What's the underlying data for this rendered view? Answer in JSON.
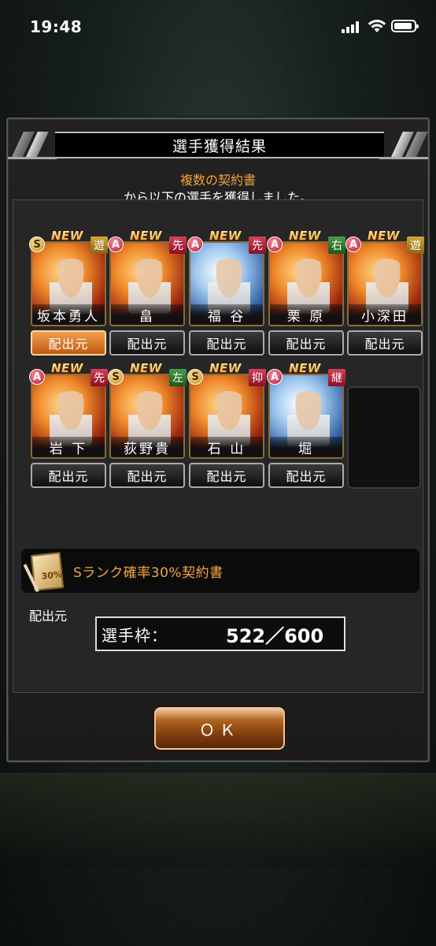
{
  "status_bar": {
    "time": "19:48"
  },
  "dialog": {
    "title": "選手獲得結果",
    "contract_name": "複数の契約書",
    "message": "から以下の選手を獲得しました。"
  },
  "players": [
    {
      "name": "坂本勇人",
      "rank": "S",
      "position": "遊",
      "position_color": "#b0882a",
      "new": "NEW",
      "button": "配出元",
      "button_active": true
    },
    {
      "name": "畠",
      "rank": "A",
      "position": "先",
      "position_color": "#b02030",
      "new": "NEW",
      "button": "配出元",
      "button_active": false
    },
    {
      "name": "福 谷",
      "rank": "A",
      "position": "先",
      "position_color": "#b02030",
      "new": "NEW",
      "button": "配出元",
      "button_active": false
    },
    {
      "name": "栗 原",
      "rank": "A",
      "position": "右",
      "position_color": "#2a7a2a",
      "new": "NEW",
      "button": "配出元",
      "button_active": false
    },
    {
      "name": "小深田",
      "rank": "A",
      "position": "遊",
      "position_color": "#b0882a",
      "new": "NEW",
      "button": "配出元",
      "button_active": false
    },
    {
      "name": "岩 下",
      "rank": "A",
      "position": "先",
      "position_color": "#b02030",
      "new": "NEW",
      "button": "配出元",
      "button_active": false
    },
    {
      "name": "荻野貴",
      "rank": "S",
      "position": "左",
      "position_color": "#2a7a2a",
      "new": "NEW",
      "button": "配出元",
      "button_active": false
    },
    {
      "name": "石 山",
      "rank": "S",
      "position": "抑",
      "position_color": "#b02030",
      "new": "NEW",
      "button": "配出元",
      "button_active": false
    },
    {
      "name": "堀",
      "rank": "A",
      "position": "継",
      "position_color": "#b02030",
      "new": "NEW",
      "button": "配出元",
      "button_active": false
    }
  ],
  "source_section": {
    "label": "配出元",
    "item_text": "Sランク確率30%契約書",
    "ticket_badge": "30%"
  },
  "capacity": {
    "label": "選手枠：",
    "value": "522／600"
  },
  "ok_button": "ＯＫ"
}
